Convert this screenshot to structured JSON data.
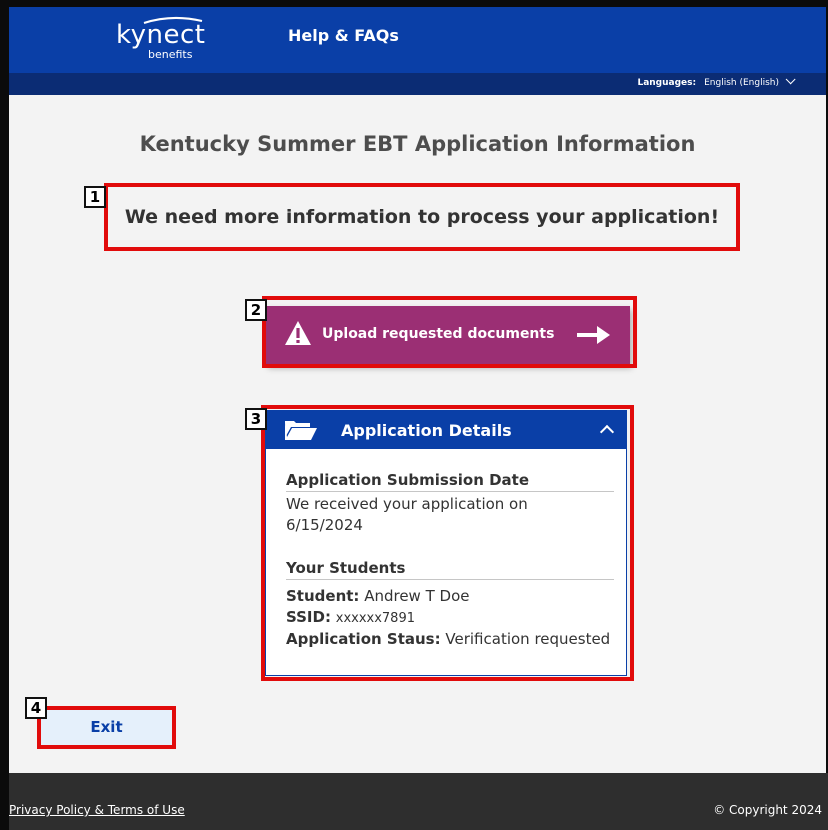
{
  "header": {
    "logo_text": "kynect",
    "logo_subtext": "benefits",
    "help_link": "Help & FAQs",
    "languages_label": "Languages:",
    "language_value": "English (English)"
  },
  "page": {
    "title": "Kentucky Summer EBT Application Information",
    "message": "We need more information to process your application!"
  },
  "upload_button": {
    "label": "Upload requested documents"
  },
  "details": {
    "header": "Application Details",
    "submission_heading": "Application Submission Date",
    "submission_text": "We received your application on",
    "submission_date": "6/15/2024",
    "students_heading": "Your Students",
    "student_label": "Student:",
    "student_value": "Andrew T Doe",
    "ssid_label": "SSID:",
    "ssid_value": "xxxxxx7891",
    "status_label": "Application Staus:",
    "status_value": "Verification requested"
  },
  "exit_button": {
    "label": "Exit"
  },
  "footer": {
    "privacy_link": "Privacy Policy & Terms of Use",
    "copyright": "© Copyright 2024"
  },
  "callouts": [
    "1",
    "2",
    "3",
    "4"
  ],
  "colors": {
    "header_blue": "#0a3fa7",
    "subbar_blue": "#0b2c74",
    "upload_purple": "#9b2f74",
    "highlight_red": "#e10b0b",
    "footer_gray": "#2e2e2e"
  },
  "icons": [
    "warning-icon",
    "arrow-right-icon",
    "folder-open-icon",
    "chevron-up-icon",
    "chevron-down-icon"
  ]
}
